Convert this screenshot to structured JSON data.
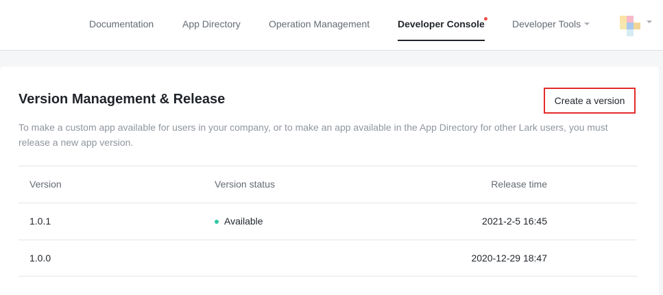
{
  "nav": {
    "items": [
      {
        "label": "Documentation"
      },
      {
        "label": "App Directory"
      },
      {
        "label": "Operation Management"
      },
      {
        "label": "Developer Console"
      },
      {
        "label": "Developer Tools"
      }
    ],
    "active": "Developer Console"
  },
  "page": {
    "title": "Version Management & Release",
    "create_button": "Create a version",
    "description": "To make a custom app available for users in your company, or to make an app available in the App Directory for other Lark users, you must release a new app version."
  },
  "table": {
    "headers": {
      "version": "Version",
      "status": "Version status",
      "time": "Release time"
    },
    "rows": [
      {
        "version": "1.0.1",
        "status": "Available",
        "time": "2021-2-5 16:45"
      },
      {
        "version": "1.0.0",
        "status": "",
        "time": "2020-12-29 18:47"
      }
    ]
  },
  "colors": {
    "accent_dot": "#f54a45",
    "status_available": "#2ec7a3",
    "highlight_border": "#e22a2a"
  }
}
